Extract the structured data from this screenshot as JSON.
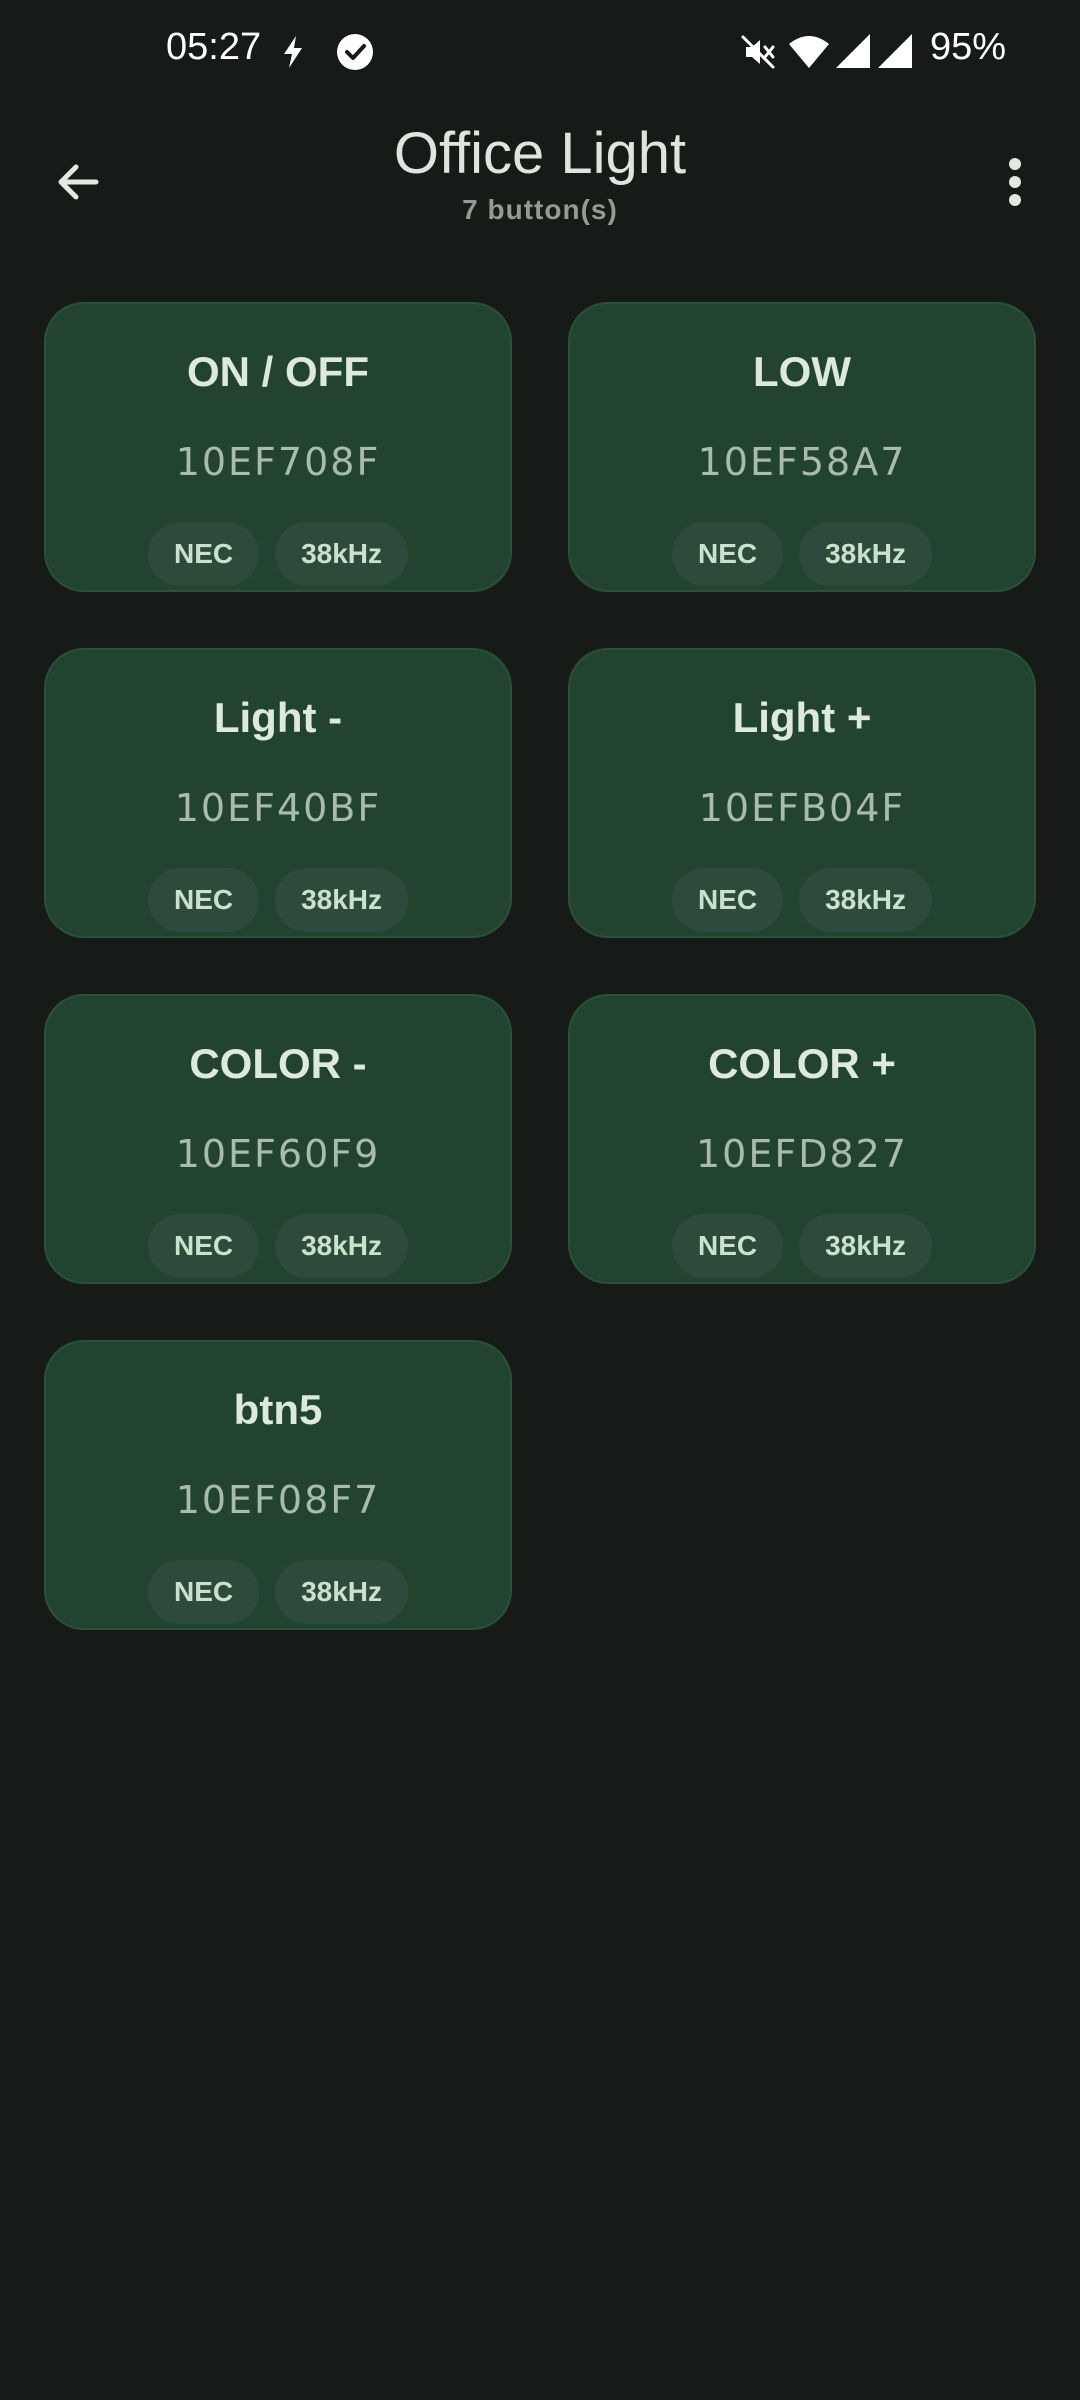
{
  "status_bar": {
    "time": "05:27",
    "battery": "95%",
    "icons": [
      "flash-icon",
      "check-circle-icon",
      "mute-icon",
      "wifi-icon",
      "signal-icon",
      "signal-icon"
    ]
  },
  "header": {
    "title": "Office Light",
    "subtitle": "7 button(s)",
    "back_icon": "arrow-back-icon",
    "menu_icon": "more-vert-icon"
  },
  "buttons": [
    {
      "name": "ON / OFF",
      "code": "10EF708F",
      "protocol": "NEC",
      "frequency": "38kHz"
    },
    {
      "name": "LOW",
      "code": "10EF58A7",
      "protocol": "NEC",
      "frequency": "38kHz"
    },
    {
      "name": "Light -",
      "code": "10EF40BF",
      "protocol": "NEC",
      "frequency": "38kHz"
    },
    {
      "name": "Light +",
      "code": "10EFB04F",
      "protocol": "NEC",
      "frequency": "38kHz"
    },
    {
      "name": "COLOR -",
      "code": "10EF60F9",
      "protocol": "NEC",
      "frequency": "38kHz"
    },
    {
      "name": "COLOR +",
      "code": "10EFD827",
      "protocol": "NEC",
      "frequency": "38kHz"
    },
    {
      "name": "btn5",
      "code": "10EF08F7",
      "protocol": "NEC",
      "frequency": "38kHz"
    }
  ],
  "colors": {
    "background": "#171b17",
    "card": "#21432f",
    "chip": "#2e4a3a",
    "text": "#dce9dc"
  }
}
